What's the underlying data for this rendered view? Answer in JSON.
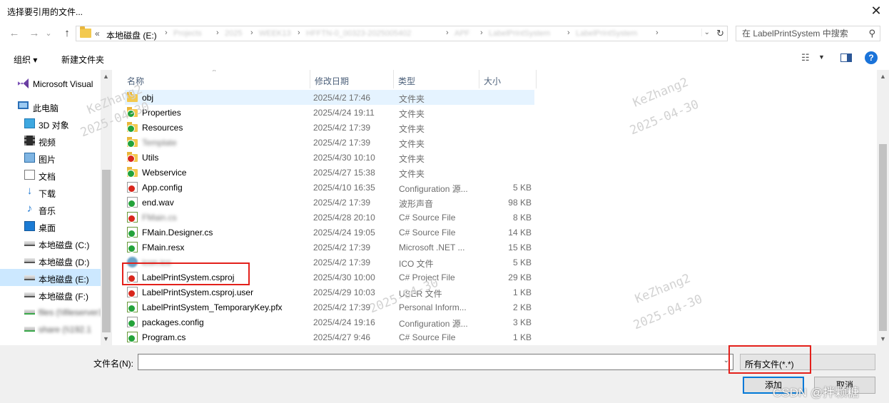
{
  "window": {
    "title": "选择要引用的文件...",
    "close": "✕"
  },
  "nav": {
    "back": "←",
    "forward": "→",
    "history": "⌄",
    "up": "↑",
    "overflow": "«",
    "root": "本地磁盘 (E:)",
    "blurred_crumbs": [
      "Projects",
      "2025",
      "WEEK13",
      "HFFTN-0_00323-2025005402",
      "APF",
      "LabelPrintSystem",
      "LabelPrintSystem"
    ],
    "search_placeholder": "在 LabelPrintSystem 中搜索"
  },
  "toolbar": {
    "organize": "组织 ▾",
    "new_folder": "新建文件夹",
    "help": "?"
  },
  "sidebar": {
    "items": [
      {
        "label": "Microsoft Visual",
        "icon": "visual-studio-icon",
        "blurred": false
      },
      {
        "label": "此电脑",
        "icon": "computer-icon",
        "blurred": false
      },
      {
        "label": "3D 对象",
        "icon": "3d-objects-icon",
        "blurred": false
      },
      {
        "label": "视频",
        "icon": "video-icon",
        "blurred": false
      },
      {
        "label": "图片",
        "icon": "pictures-icon",
        "blurred": false
      },
      {
        "label": "文档",
        "icon": "documents-icon",
        "blurred": false
      },
      {
        "label": "下载",
        "icon": "downloads-icon",
        "blurred": false
      },
      {
        "label": "音乐",
        "icon": "music-icon",
        "blurred": false
      },
      {
        "label": "桌面",
        "icon": "desktop-icon",
        "blurred": false
      },
      {
        "label": "本地磁盘 (C:)",
        "icon": "drive-icon",
        "blurred": false
      },
      {
        "label": "本地磁盘 (D:)",
        "icon": "drive-icon",
        "blurred": false
      },
      {
        "label": "本地磁盘 (E:)",
        "icon": "drive-icon",
        "blurred": false,
        "selected": true
      },
      {
        "label": "本地磁盘 (F:)",
        "icon": "drive-icon",
        "blurred": false
      },
      {
        "label": "files (\\\\fileserver1",
        "icon": "network-drive-icon",
        "blurred": true
      },
      {
        "label": "share (\\\\192.1",
        "icon": "network-drive-icon",
        "blurred": true
      }
    ]
  },
  "columns": {
    "name": "名称",
    "date": "修改日期",
    "type": "类型",
    "size": "大小"
  },
  "files": [
    {
      "name": "obj",
      "date": "2025/4/2 17:46",
      "type": "文件夹",
      "size": "",
      "icon": "folder-icon",
      "badge": ""
    },
    {
      "name": "Properties",
      "date": "2025/4/24 19:11",
      "type": "文件夹",
      "size": "",
      "icon": "folder-icon",
      "badge": "g"
    },
    {
      "name": "Resources",
      "date": "2025/4/2 17:39",
      "type": "文件夹",
      "size": "",
      "icon": "folder-icon",
      "badge": "g"
    },
    {
      "name": "Template",
      "date": "2025/4/2 17:39",
      "type": "文件夹",
      "size": "",
      "icon": "folder-icon",
      "badge": "g"
    },
    {
      "name": "Utils",
      "date": "2025/4/30 10:10",
      "type": "文件夹",
      "size": "",
      "icon": "folder-icon",
      "badge": "r"
    },
    {
      "name": "Webservice",
      "date": "2025/4/27 15:38",
      "type": "文件夹",
      "size": "",
      "icon": "folder-icon",
      "badge": "g"
    },
    {
      "name": "App.config",
      "date": "2025/4/10 16:35",
      "type": "Configuration 源...",
      "size": "5 KB",
      "icon": "config-file-icon",
      "badge": "r"
    },
    {
      "name": "end.wav",
      "date": "2025/4/2 17:39",
      "type": "波形声音",
      "size": "98 KB",
      "icon": "audio-file-icon",
      "badge": "g"
    },
    {
      "name": "FMain.cs",
      "date": "2025/4/28 20:10",
      "type": "C# Source File",
      "size": "8 KB",
      "icon": "csharp-file-icon",
      "badge": "r"
    },
    {
      "name": "FMain.Designer.cs",
      "date": "2025/4/24 19:05",
      "type": "C# Source File",
      "size": "14 KB",
      "icon": "csharp-file-icon",
      "badge": "g"
    },
    {
      "name": "FMain.resx",
      "date": "2025/4/2 17:39",
      "type": "Microsoft .NET ...",
      "size": "15 KB",
      "icon": "resx-file-icon",
      "badge": "g"
    },
    {
      "name": "icon.ico",
      "date": "2025/4/2 17:39",
      "type": "ICO 文件",
      "size": "5 KB",
      "icon": "ico-file-icon",
      "badge": ""
    },
    {
      "name": "LabelPrintSystem.csproj",
      "date": "2025/4/30 10:00",
      "type": "C# Project File",
      "size": "29 KB",
      "icon": "csproj-file-icon",
      "badge": "r"
    },
    {
      "name": "LabelPrintSystem.csproj.user",
      "date": "2025/4/29 10:03",
      "type": "USER 文件",
      "size": "1 KB",
      "icon": "user-file-icon",
      "badge": "r"
    },
    {
      "name": "LabelPrintSystem_TemporaryKey.pfx",
      "date": "2025/4/2 17:39",
      "type": "Personal Inform...",
      "size": "2 KB",
      "icon": "pfx-file-icon",
      "badge": "g"
    },
    {
      "name": "packages.config",
      "date": "2025/4/24 19:16",
      "type": "Configuration 源...",
      "size": "3 KB",
      "icon": "config-file-icon",
      "badge": "g"
    },
    {
      "name": "Program.cs",
      "date": "2025/4/27 9:46",
      "type": "C# Source File",
      "size": "1 KB",
      "icon": "csharp-file-icon",
      "badge": "g"
    }
  ],
  "bottom": {
    "filename_label": "文件名(N):",
    "filename_value": "",
    "filter": "所有文件(*.*)",
    "add": "添加",
    "cancel": "取消"
  },
  "watermarks": {
    "user": "KeZhang2",
    "date": "2025-04-30",
    "csdn": "CSDN @拌颗糖"
  },
  "colors": {
    "highlight_red": "#e3201b",
    "selection_blue": "#cce8ff",
    "accent": "#0078d7"
  }
}
